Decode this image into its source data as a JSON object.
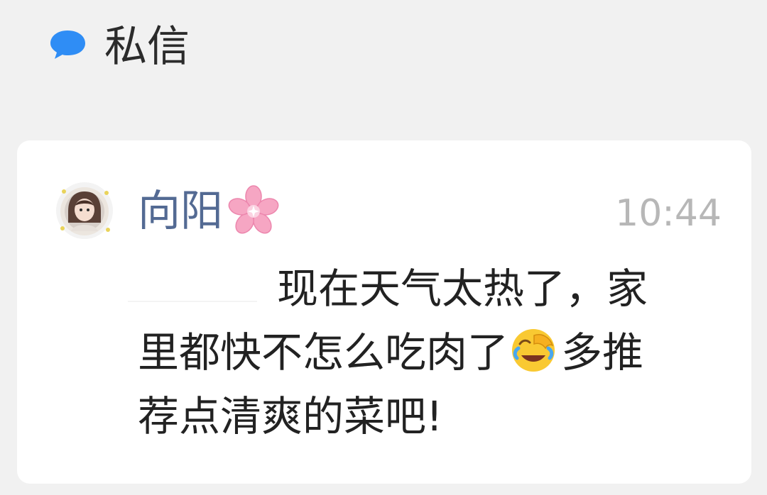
{
  "header": {
    "icon": "chat-bubble-icon",
    "title": "私信",
    "accent_color": "#2f8df5"
  },
  "message": {
    "avatar": "avatar-girl",
    "sender_name": "向阳",
    "name_emoji": "cherry-blossom-icon",
    "time": "10:44",
    "text_part1": "现在天气太热了，家",
    "text_part2": "里都快不怎么吃肉了",
    "emoji": "face-palm-laughing-icon",
    "text_part3": "多推",
    "text_part4": "荐点清爽的菜吧!"
  }
}
